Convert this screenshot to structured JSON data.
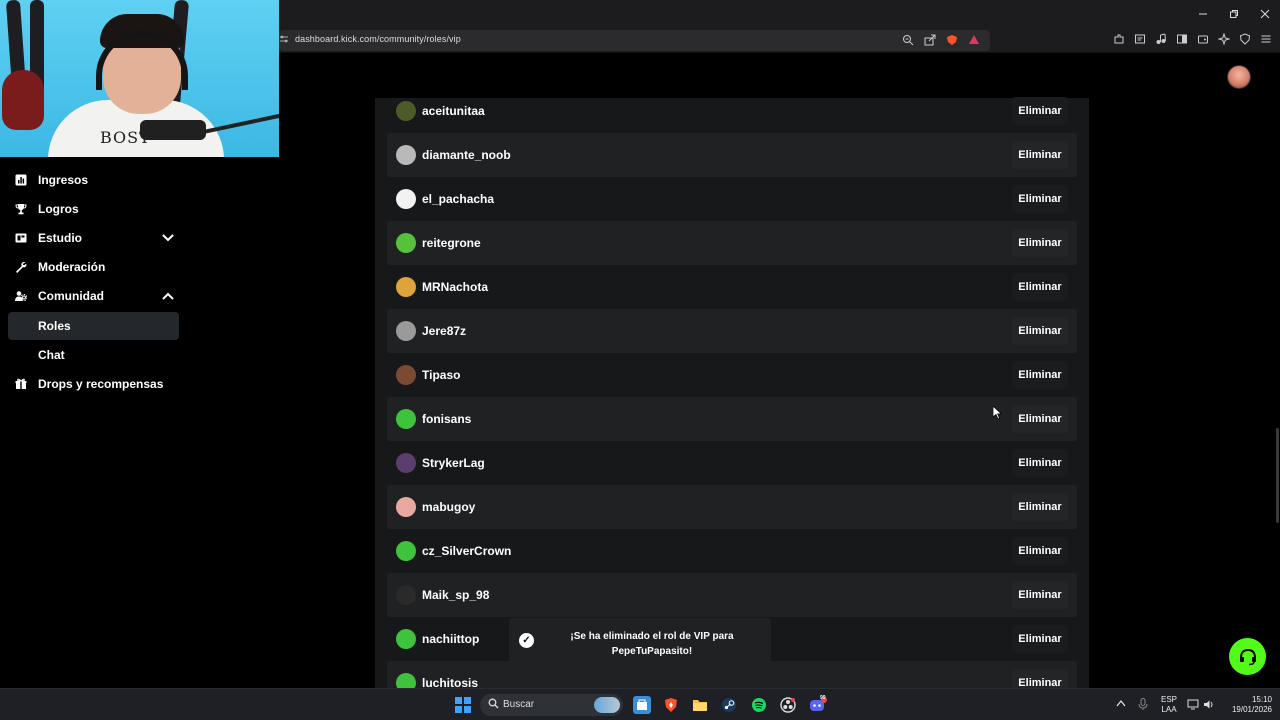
{
  "browser": {
    "url": "dashboard.kick.com/community/roles/vip",
    "window_controls": [
      "minimize",
      "restore",
      "close"
    ]
  },
  "sidebar": {
    "items": [
      {
        "label": "Ingresos",
        "icon": "bar-chart-icon"
      },
      {
        "label": "Logros",
        "icon": "trophy-icon"
      },
      {
        "label": "Estudio",
        "icon": "studio-icon",
        "expandable": true
      },
      {
        "label": "Moderación",
        "icon": "wrench-icon"
      },
      {
        "label": "Comunidad",
        "icon": "community-icon",
        "expanded": true
      },
      {
        "label": "Roles",
        "sub": true,
        "active": true
      },
      {
        "label": "Chat",
        "sub": true
      },
      {
        "label": "Drops y recompensas",
        "icon": "gift-icon"
      }
    ]
  },
  "vip_list": {
    "remove_label": "Eliminar",
    "users": [
      {
        "name": "aceitunitaa",
        "avatar_color": "#4d5a2a"
      },
      {
        "name": "diamante_noob",
        "avatar_color": "#b9b9b9"
      },
      {
        "name": "el_pachacha",
        "avatar_color": "#f2f2f2"
      },
      {
        "name": "reitegrone",
        "avatar_color": "#56c23c"
      },
      {
        "name": "MRNachota",
        "avatar_color": "#e0a23a"
      },
      {
        "name": "Jere87z",
        "avatar_color": "#9a9a9a"
      },
      {
        "name": "Tipaso",
        "avatar_color": "#7a4a33"
      },
      {
        "name": "fonisans",
        "avatar_color": "#3fc23c"
      },
      {
        "name": "StrykerLag",
        "avatar_color": "#5a3e6e"
      },
      {
        "name": "mabugoy",
        "avatar_color": "#e9a9a0"
      },
      {
        "name": "cz_SilverCrown",
        "avatar_color": "#3fc23c"
      },
      {
        "name": "Maik_sp_98",
        "avatar_color": "#2a2a2a"
      },
      {
        "name": "nachiittop",
        "avatar_color": "#3fc23c"
      },
      {
        "name": "luchitosis",
        "avatar_color": "#3fc23c"
      }
    ]
  },
  "toast": {
    "message": "¡Se ha eliminado el rol de VIP para PepeTuPapasito!"
  },
  "webcam": {
    "shirt_text": "BOST"
  },
  "taskbar": {
    "search_placeholder": "Buscar",
    "lang_top": "ESP",
    "lang_bottom": "LAA",
    "time": "15:10",
    "date": "19/01/2026",
    "badge_count": "99"
  },
  "colors": {
    "accent_green": "#53fc18",
    "panel_bg": "#17181a",
    "row_alt_bg": "#1f2123"
  }
}
